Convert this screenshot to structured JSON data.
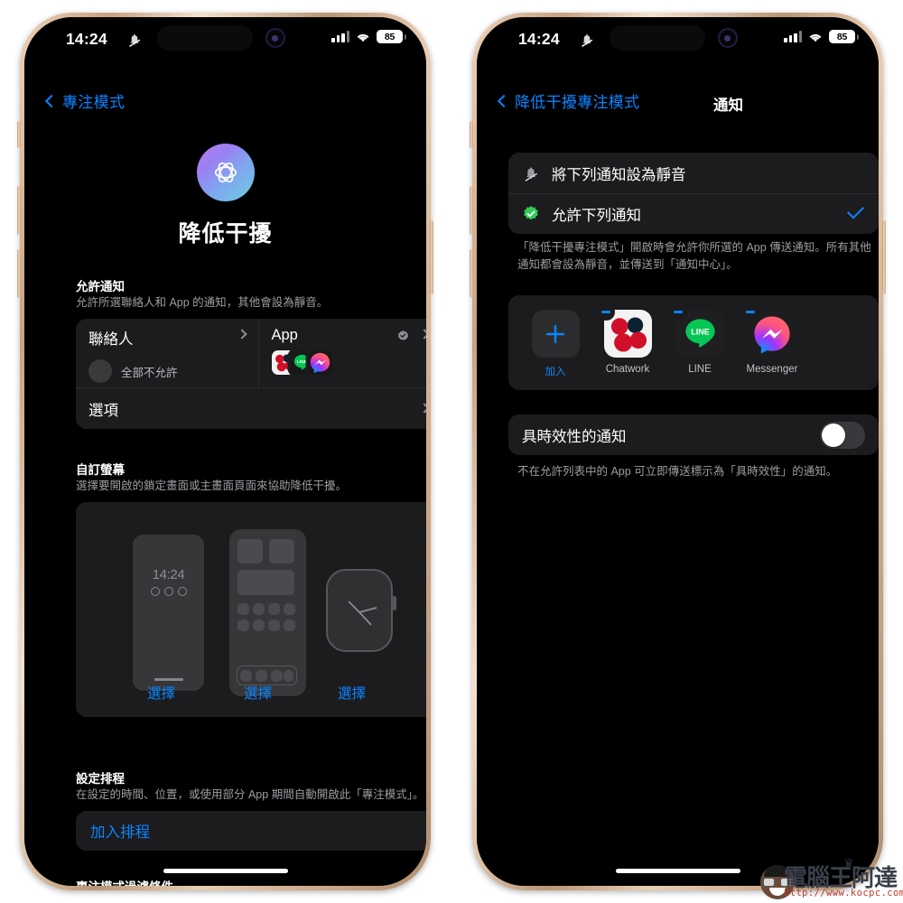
{
  "meta": {
    "platform": "iOS Settings — Focus",
    "accent_blue": "#0a84ff",
    "card_bg": "#1c1c1e",
    "screen_bg": "#000000"
  },
  "status_bar": {
    "time": "14:24",
    "silent_icon": "bell-slash-icon",
    "cellular_icon": "cellular-bars-icon",
    "wifi_icon": "wifi-icon",
    "battery_percent": "85"
  },
  "left_phone": {
    "nav": {
      "back_label": "專注模式",
      "back_icon": "chevron-left-icon"
    },
    "hero": {
      "icon_name": "reduce-interruptions-focus-icon",
      "title": "降低干擾"
    },
    "allow_notifications": {
      "section_title": "允許通知",
      "section_desc": "允許所選聯絡人和 App 的通知，其他會設為靜音。",
      "people": {
        "title": "聯絡人",
        "subtitle": "全部不允許",
        "avatar_icon": "empty-avatar-icon",
        "chevron_icon": "chevron-right-icon"
      },
      "apps": {
        "title": "App",
        "badge_icon": "verified-seal-icon",
        "chevron_icon": "chevron-right-icon",
        "icons": [
          "Chatwork",
          "LINE",
          "Messenger"
        ]
      },
      "options_label": "選項"
    },
    "custom_screens": {
      "section_title": "自訂螢幕",
      "section_desc": "選擇要開啟的鎖定畫面或主畫面頁面來協助降低干擾。",
      "mock_lock_time": "14:24",
      "choices": [
        {
          "label": "選擇",
          "target": "lock-screen"
        },
        {
          "label": "選擇",
          "target": "home-screen"
        },
        {
          "label": "選擇",
          "target": "watch-face"
        }
      ]
    },
    "schedule": {
      "section_title": "設定排程",
      "section_desc": "在設定的時間、位置，或使用部分 App 期間自動開啟此「專注模式」。",
      "add_label": "加入排程"
    },
    "filter_label": "專注模式過濾條件"
  },
  "right_phone": {
    "nav": {
      "back_label": "降低干擾專注模式",
      "back_icon": "chevron-left-icon",
      "title": "通知"
    },
    "mode_options": [
      {
        "label": "將下列通知設為靜音",
        "icon": "bell-slash-icon",
        "selected": false
      },
      {
        "label": "允許下列通知",
        "icon": "green-check-seal-icon",
        "selected": true
      }
    ],
    "mode_desc": "「降低干擾專注模式」開啟時會允許你所選的 App 傳送通知。所有其他通知都會設為靜音，並傳送到「通知中心」。",
    "apps": [
      {
        "label": "加入",
        "type": "add",
        "icon": "plus-icon"
      },
      {
        "label": "Chatwork",
        "type": "app",
        "icon": "chatwork-icon",
        "remove_icon": "minus-icon"
      },
      {
        "label": "LINE",
        "type": "app",
        "icon": "line-icon",
        "remove_icon": "minus-icon"
      },
      {
        "label": "Messenger",
        "type": "app",
        "icon": "messenger-icon",
        "remove_icon": "minus-icon"
      }
    ],
    "time_sensitive": {
      "label": "具時效性的通知",
      "toggle_state": "off",
      "desc": "不在允許列表中的 App 可立即傳送標示為「具時效性」的通知。"
    }
  },
  "watermark": {
    "text": "電腦王阿達",
    "url": "http://www.kocpc.com.tw"
  }
}
